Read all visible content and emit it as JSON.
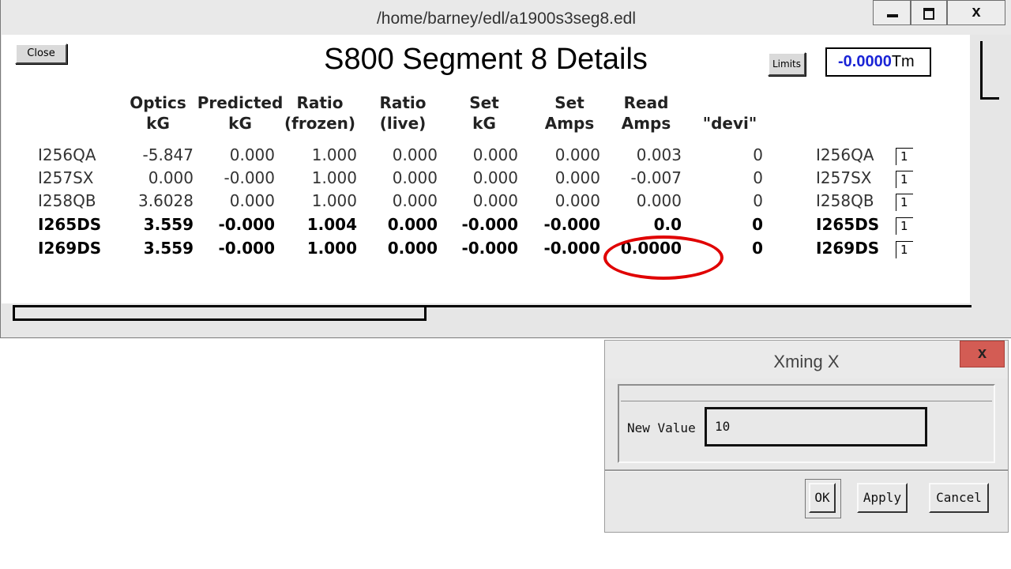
{
  "main_window": {
    "title": "/home/barney/edl/a1900s3seg8.edl",
    "controls": {
      "close_glyph": "x"
    }
  },
  "edl": {
    "close_label": "Close",
    "page_title": "S800 Segment 8 Details",
    "limits_label": "Limits",
    "tm_value": "-0.0000",
    "tm_unit": "Tm",
    "headers": [
      [
        "Optics",
        "kG"
      ],
      [
        "Predicted",
        "kG"
      ],
      [
        "Ratio",
        "(frozen)"
      ],
      [
        "Ratio",
        "(live)"
      ],
      [
        "Set",
        "kG"
      ],
      [
        "Set",
        "Amps"
      ],
      [
        "Read",
        "Amps"
      ],
      [
        "\"devi\"",
        ""
      ]
    ],
    "rows": [
      {
        "name": "I256QA",
        "optics": "-5.847",
        "predicted": "0.000",
        "ratio_frozen": "1.000",
        "ratio_live": "0.000",
        "set_kg": "0.000",
        "set_amps": "0.000",
        "read_amps": "0.003",
        "devi": "0",
        "name2": "I256QA",
        "box": "1",
        "bold": false
      },
      {
        "name": "I257SX",
        "optics": "0.000",
        "predicted": "-0.000",
        "ratio_frozen": "1.000",
        "ratio_live": "0.000",
        "set_kg": "0.000",
        "set_amps": "0.000",
        "read_amps": "-0.007",
        "devi": "0",
        "name2": "I257SX",
        "box": "1",
        "bold": false
      },
      {
        "name": "I258QB",
        "optics": "3.6028",
        "predicted": "0.000",
        "ratio_frozen": "1.000",
        "ratio_live": "0.000",
        "set_kg": "0.000",
        "set_amps": "0.000",
        "read_amps": "0.000",
        "devi": "0",
        "name2": "I258QB",
        "box": "1",
        "bold": false
      },
      {
        "name": "I265DS",
        "optics": "3.559",
        "predicted": "-0.000",
        "ratio_frozen": "1.004",
        "ratio_live": "0.000",
        "set_kg": "-0.000",
        "set_amps": "-0.000",
        "read_amps": "0.0",
        "devi": "0",
        "name2": "I265DS",
        "box": "1",
        "bold": true
      },
      {
        "name": "I269DS",
        "optics": "3.559",
        "predicted": "-0.000",
        "ratio_frozen": "1.000",
        "ratio_live": "0.000",
        "set_kg": "-0.000",
        "set_amps": "-0.000",
        "read_amps": "0.0000",
        "devi": "0",
        "name2": "I269DS",
        "box": "1",
        "bold": true
      }
    ]
  },
  "dialog": {
    "title": "Xming X",
    "close_glyph": "x",
    "field_label": "New Value",
    "field_value": "10",
    "ok_label": "OK",
    "apply_label": "Apply",
    "cancel_label": "Cancel"
  },
  "colors": {
    "tm_value": "#1a24d6",
    "annotation": "#e00000",
    "dialog_close": "#d35c54"
  }
}
